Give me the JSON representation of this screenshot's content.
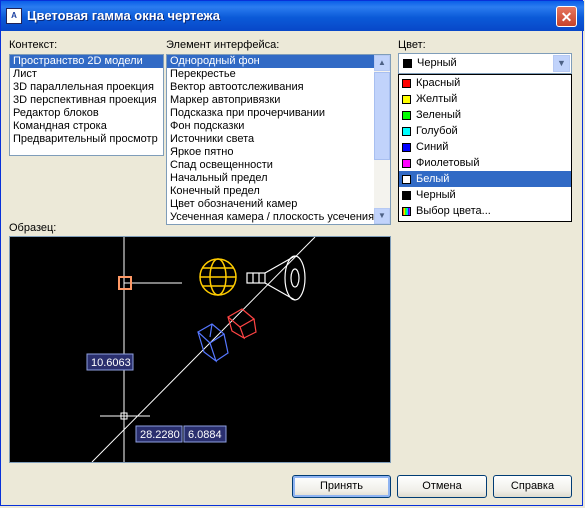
{
  "window": {
    "title": "Цветовая гамма окна чертежа",
    "icon_name": "autocad-icon",
    "close_label": "✕"
  },
  "context": {
    "label": "Контекст:",
    "items": [
      "Пространство 2D модели",
      "Лист",
      "3D параллельная проекция",
      "3D перспективная проекция",
      "Редактор блоков",
      "Командная строка",
      "Предварительный просмотр"
    ],
    "selected_index": 0
  },
  "element": {
    "label": "Элемент интерфейса:",
    "items": [
      "Однородный фон",
      "Перекрестье",
      "Вектор автоотслеживания",
      "Маркер автопривязки",
      "Подсказка при прочерчивании",
      "Фон подсказки",
      "Источники света",
      "Яркое пятно",
      "Спад освещенности",
      "Начальный предел",
      "Конечный предел",
      "Цвет обозначений камер",
      "Усеченная камера / плоскость усечения"
    ],
    "selected_index": 0
  },
  "color": {
    "label": "Цвет:",
    "current": "Черный",
    "current_swatch": "#000000",
    "options": [
      {
        "label": "Красный",
        "swatch": "#ff0000"
      },
      {
        "label": "Желтый",
        "swatch": "#ffff00"
      },
      {
        "label": "Зеленый",
        "swatch": "#00ff00"
      },
      {
        "label": "Голубой",
        "swatch": "#00ffff"
      },
      {
        "label": "Синий",
        "swatch": "#0000ff"
      },
      {
        "label": "Фиолетовый",
        "swatch": "#ff00ff"
      },
      {
        "label": "Белый",
        "swatch": "#ffffff"
      },
      {
        "label": "Черный",
        "swatch": "#000000"
      },
      {
        "label": "Выбор цвета...",
        "swatch": "multicolor"
      }
    ],
    "highlighted_index": 6
  },
  "preview": {
    "label": "Образец:",
    "dim1": "10.6063",
    "dim2": "28.2280",
    "dim3": "6.0884"
  },
  "buttons": {
    "accept": "Принять",
    "cancel": "Отмена",
    "help": "Справка"
  }
}
